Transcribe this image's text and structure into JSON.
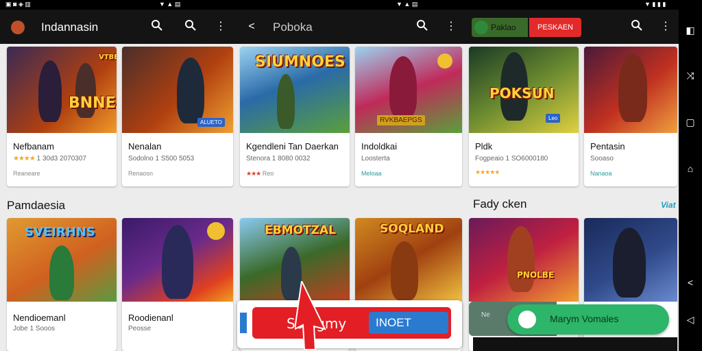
{
  "status_bar": {
    "left_icons": "▣ ◙ ◈ ▥",
    "mid_icons": "▼ ▲ ▤",
    "right_icons": "▼ ▮ ▮ ▮"
  },
  "top_bar": {
    "app_title": "Indannasin",
    "center_title": "Poboka",
    "green_button_label": "Paklao",
    "red_button_label": "PESKAEN"
  },
  "row1": [
    {
      "name": "Nefbanam",
      "sub_stars": "★★★★",
      "sub_text": "1 30d3 2070307",
      "dev": "Reaneare",
      "art_title": "BNNEAV",
      "art_top": "VTBBVCGI",
      "badge": "ALUETO",
      "colors": [
        "#3a2a55",
        "#b04010",
        "#f09a2a"
      ]
    },
    {
      "name": "Nenalan",
      "sub_stars": "",
      "sub_text": "Sodolno 1 S500 5053",
      "dev": "Renaosn",
      "art_title": "",
      "art_top": "",
      "badge": "",
      "colors": [
        "#3a2a55",
        "#b04010",
        "#f09a2a"
      ]
    },
    {
      "name": "Kgendleni Tan Daerkan",
      "sub_stars": "",
      "sub_text": "Stenora 1 8080 0032",
      "dev": "Reo",
      "dev_stars": "★★★",
      "art_title": "SIUMNOES",
      "art_top": "",
      "badge": "RVKBAEPGS",
      "colors": [
        "#2a6aa8",
        "#5aa03a",
        "#9cd2f0"
      ]
    },
    {
      "name": "Indoldkai",
      "sub_stars": "",
      "sub_text": "Loosterta",
      "dev": "Meloaa",
      "art_title": "",
      "art_top": "",
      "badge": "",
      "colors": [
        "#2a6aa8",
        "#5aa03a",
        "#9cd2f0"
      ]
    },
    {
      "name": "Pldk",
      "sub_stars": "",
      "sub_text": "Fogpeaio 1 SO6000180",
      "dev": "",
      "dev_stars": "★★★★★",
      "art_title": "POKSUN",
      "art_top": "",
      "badge": "Leo",
      "colors": [
        "#1a3a25",
        "#6a8a30",
        "#e0d040"
      ]
    },
    {
      "name": "Pentasin",
      "sub_stars": "",
      "sub_text": "Sooaso",
      "dev": "Nanaoa",
      "art_title": "",
      "art_top": "",
      "badge": "",
      "colors": [
        "#4a1a3a",
        "#c03020",
        "#f0a040"
      ]
    }
  ],
  "sections": {
    "left_title": "Pamdaesia",
    "right_title": "Fady cken",
    "right_link": "Viat"
  },
  "row2": [
    {
      "name": "Nendioemanl",
      "sub": "Jobe 1 Sooos",
      "art_title": "SVEIRHNS",
      "colors": [
        "#e09a30",
        "#d06020",
        "#5a9a40"
      ]
    },
    {
      "name": "Roodienanl",
      "sub": "Peosse",
      "art_title": "",
      "colors": [
        "#3a1a6a",
        "#e04020",
        "#f0a020"
      ]
    },
    {
      "name": "",
      "sub": "",
      "art_title": "EBMOTZAL",
      "colors": [
        "#3a6a2a",
        "#c04020",
        "#e0b040"
      ]
    },
    {
      "name": "",
      "sub": "",
      "art_title": "SOQLAND",
      "colors": [
        "#d08a20",
        "#a04010",
        "#f0c040"
      ]
    },
    {
      "name": "",
      "sub": "",
      "art_title": "PNOLBE",
      "colors": [
        "#6a1a5a",
        "#c02040",
        "#f0a030"
      ]
    },
    {
      "name": "",
      "sub": "",
      "art_title": "",
      "colors": [
        "#1a2a5a",
        "#304a8a",
        "#6a8ad0"
      ]
    }
  ],
  "overlays": {
    "ad_label_red": "Sopigmy",
    "ad_label_blue": "INOET",
    "green_pill_label": "Marym Vomales",
    "green_card_small": "Ne"
  }
}
